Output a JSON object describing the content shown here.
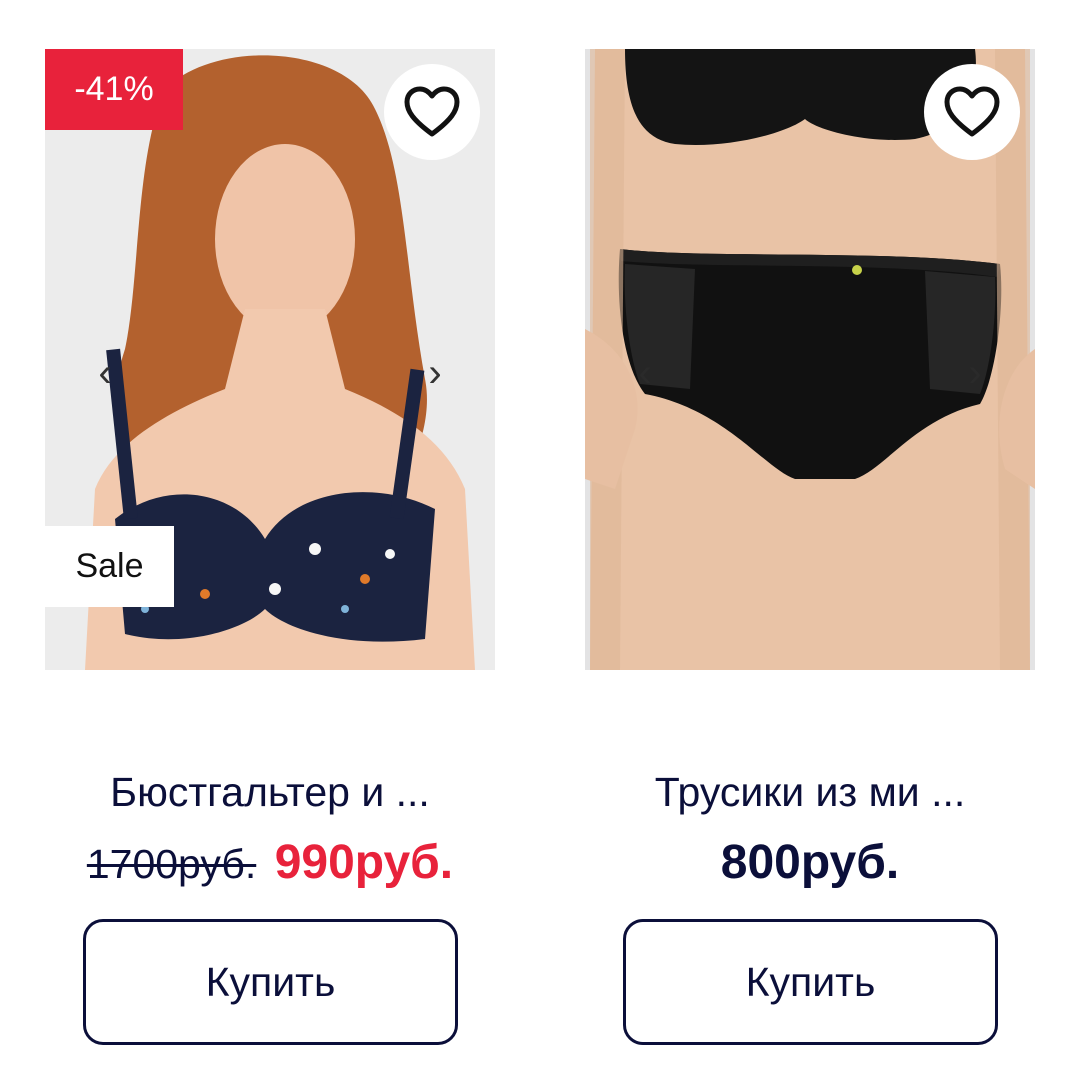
{
  "colors": {
    "navy": "#0b0f3a",
    "sale_red": "#e8223b",
    "white": "#ffffff"
  },
  "products": [
    {
      "discount": "-41%",
      "sale_label": "Sale",
      "prev_arrow": "‹",
      "next_arrow": "›",
      "favorite_icon": "heart-outline-icon",
      "title": "Бюстгальтер и ...",
      "old_price": "1700руб.",
      "price": "990руб.",
      "buy_label": "Купить"
    },
    {
      "prev_arrow": "‹",
      "next_arrow": "›",
      "favorite_icon": "heart-outline-icon",
      "title": "Трусики из ми ...",
      "price": "800руб.",
      "buy_label": "Купить"
    }
  ]
}
